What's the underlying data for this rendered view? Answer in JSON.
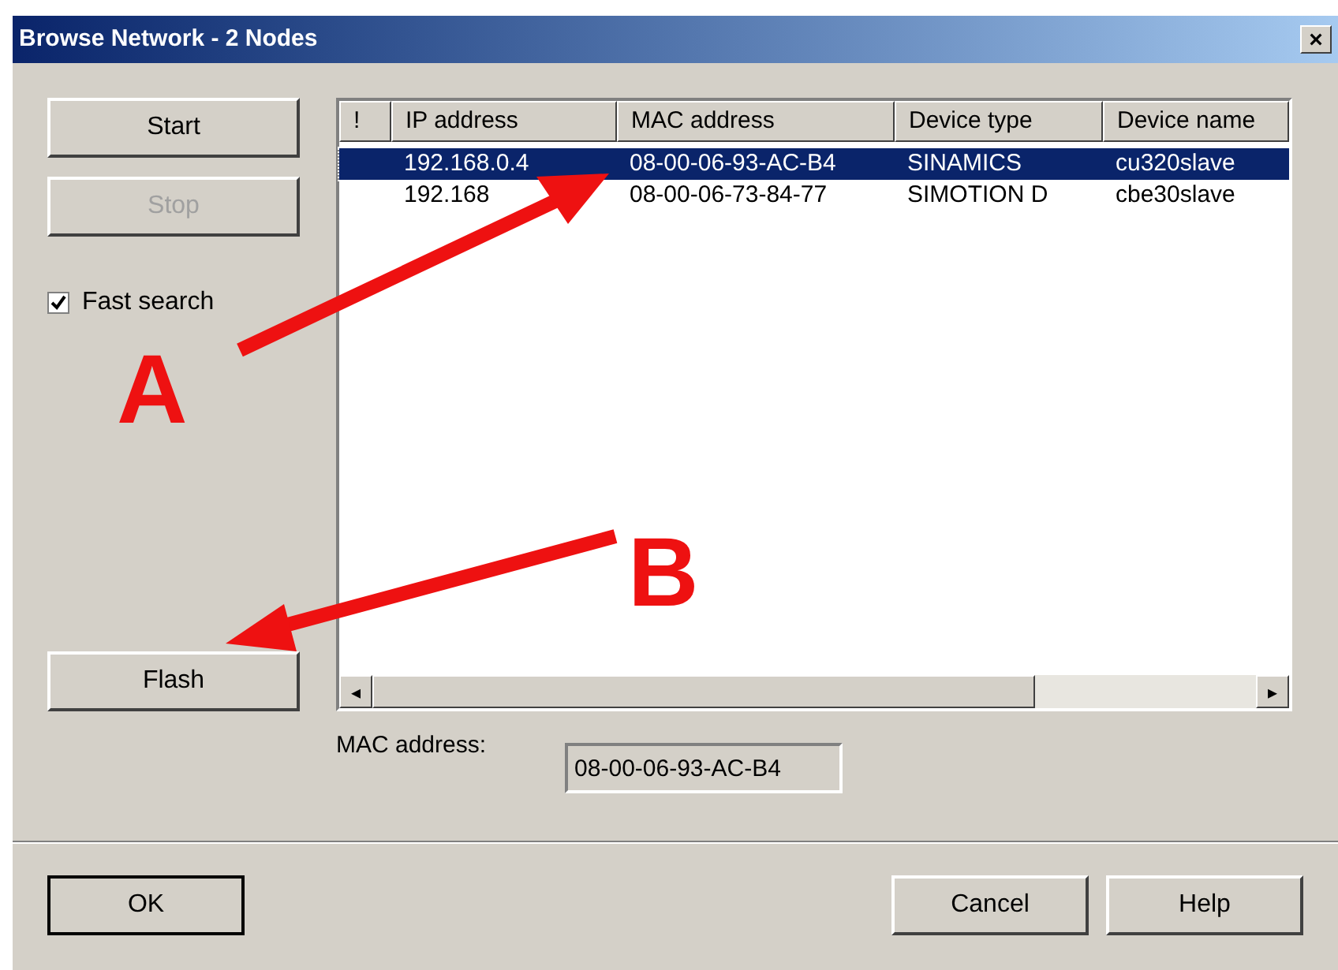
{
  "window": {
    "title": "Browse Network - 2 Nodes",
    "close": "×"
  },
  "buttons": [
    {
      "label": "Start",
      "disabled": false
    },
    {
      "label": "Stop",
      "disabled": true
    }
  ],
  "fast_search": {
    "label": "Fast search",
    "checked": true
  },
  "table": {
    "columns": [
      "!",
      "IP address",
      "MAC address",
      "Device type",
      "Device name"
    ],
    "rows": [
      {
        "cells": [
          "",
          "192.168.0.4",
          "08-00-06-93-AC-B4",
          "SINAMICS",
          "cu320slave"
        ],
        "selected": true
      },
      {
        "cells": [
          "",
          "192.168",
          "08-00-06-73-84-77",
          "SIMOTION D",
          "cbe30slave"
        ],
        "selected": false
      }
    ],
    "scroll_left": "◂",
    "scroll_right": "▸"
  },
  "flash": {
    "label": "Flash",
    "disabled": false
  },
  "mac_field": {
    "label": "MAC address:",
    "value": "08-00-06-93-AC-B4"
  },
  "footer": [
    "OK",
    "Cancel",
    "Help"
  ],
  "annotations": [
    {
      "label": "A"
    },
    {
      "label": "B"
    }
  ]
}
